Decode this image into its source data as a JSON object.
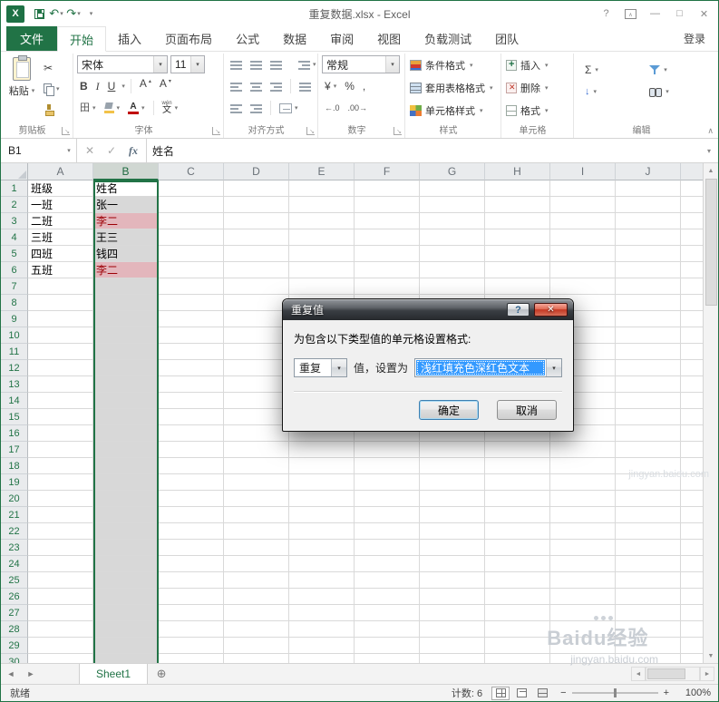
{
  "titlebar": {
    "title": "重复数据.xlsx - Excel"
  },
  "ribbon_tabs": {
    "file": "文件",
    "items": [
      {
        "label": "开始",
        "active": true
      },
      {
        "label": "插入",
        "active": false
      },
      {
        "label": "页面布局",
        "active": false
      },
      {
        "label": "公式",
        "active": false
      },
      {
        "label": "数据",
        "active": false
      },
      {
        "label": "审阅",
        "active": false
      },
      {
        "label": "视图",
        "active": false
      },
      {
        "label": "负载测试",
        "active": false
      },
      {
        "label": "团队",
        "active": false
      }
    ],
    "signin": "登录"
  },
  "ribbon": {
    "clipboard": {
      "label": "剪贴板",
      "paste": "粘贴"
    },
    "font": {
      "label": "字体",
      "name": "宋体",
      "size": "11",
      "bold": "B",
      "italic": "I",
      "underline": "U",
      "letter": "A",
      "phonetic": "文",
      "phonetic_mark": "wén"
    },
    "alignment": {
      "label": "对齐方式"
    },
    "number": {
      "label": "数字",
      "format": "常规"
    },
    "styles": {
      "label": "样式",
      "items": [
        "条件格式",
        "套用表格格式",
        "单元格样式"
      ]
    },
    "cells": {
      "label": "单元格",
      "items": [
        "插入",
        "删除",
        "格式"
      ]
    },
    "editing": {
      "label": "编辑"
    }
  },
  "formula_bar": {
    "name_box": "B1",
    "fx": "fx",
    "value": "姓名"
  },
  "grid": {
    "col_headers": [
      "A",
      "B",
      "C",
      "D",
      "E",
      "F",
      "G",
      "H",
      "I",
      "J"
    ],
    "selected_col": "B",
    "active_cell": "B1",
    "row_count": 30,
    "data": {
      "A": [
        "班级",
        "一班",
        "二班",
        "三班",
        "四班",
        "五班"
      ],
      "B": [
        "姓名",
        "张一",
        "李二",
        "王三",
        "钱四",
        "李二"
      ]
    },
    "duplicate_rows": [
      3,
      6
    ]
  },
  "dialog": {
    "title": "重复值",
    "label": "为包含以下类型值的单元格设置格式:",
    "condition_value": "重复",
    "middle_label": "值，设置为",
    "format_value": "浅红填充色深红色文本",
    "ok": "确定",
    "cancel": "取消"
  },
  "sheet_bar": {
    "tab": "Sheet1"
  },
  "status_bar": {
    "ready": "就绪",
    "count": "计数: 6",
    "zoom": "100%"
  },
  "watermark": {
    "brand": "Baidu经验",
    "url": "jingyan.baidu.com"
  },
  "glyphs": {
    "undo": "↶",
    "redo": "↷",
    "dropdown": "▾",
    "help": "?",
    "minimize": "—",
    "maximize": "□",
    "close": "✕",
    "cancel_x": "✕",
    "check": "✓",
    "scissors": "✂",
    "sum": "Σ",
    "borders": "田",
    "yen": "¥",
    "percent": "%",
    "comma": ",",
    "inc_decimal": "←.0",
    "dec_decimal": ".00→",
    "tri_up": "▴",
    "tri_down": "▾",
    "fill_down": "↓",
    "nav_left": "◄",
    "nav_right": "►",
    "scroll_up": "▲",
    "scroll_down": "▼",
    "new_sheet": "⊕",
    "zoom_minus": "−",
    "zoom_plus": "+",
    "collapse": "∧",
    "launcher": "↘",
    "app_logo": "X"
  },
  "colors": {
    "theme_green": "#217346",
    "duplicate_fill": "#e3b6bc",
    "duplicate_text": "#9c0006",
    "selection_fill": "#d8d8d8",
    "combo_highlight": "#3399ff"
  }
}
